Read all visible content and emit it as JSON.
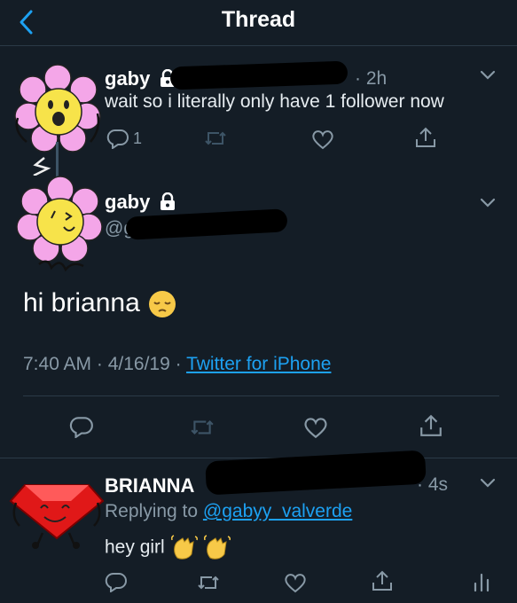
{
  "header": {
    "title": "Thread"
  },
  "tweets": [
    {
      "name": "gaby",
      "time": "2h",
      "text": "wait so i literally only have 1 follower now",
      "reply_count": "1"
    },
    {
      "name": "gaby",
      "handle_partial": "@g",
      "text": "hi brianna",
      "timestamp": "7:40 AM · 4/16/19 · ",
      "source": "Twitter for iPhone"
    },
    {
      "name": "BRIANNA",
      "time": "4s",
      "replying_prefix": "Replying to ",
      "replying_to": "@gabyy_valverde",
      "text": "hey girl"
    }
  ],
  "icons": [
    "back-icon",
    "lock-icon",
    "chevron-down-icon",
    "reply-icon",
    "retweet-icon",
    "like-icon",
    "share-icon",
    "analytics-icon",
    "pensive-emoji",
    "waving-hand-emoji"
  ],
  "colors": {
    "background": "#141d26",
    "link": "#1da1f2",
    "muted": "#8899a6",
    "text": "#e6ecf0"
  }
}
